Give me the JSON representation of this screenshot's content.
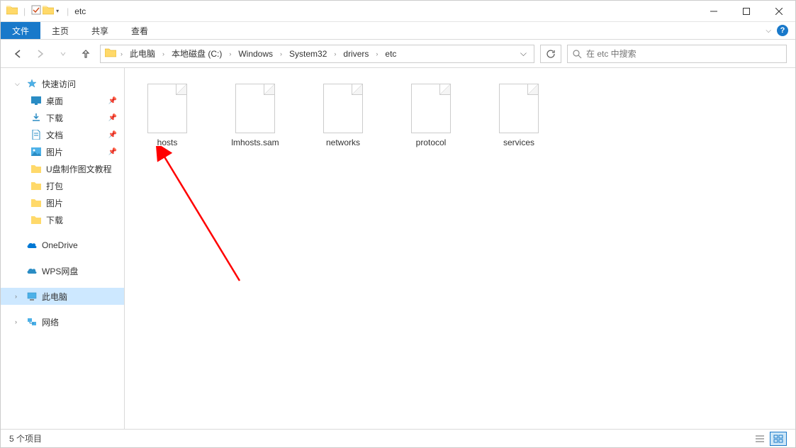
{
  "titlebar": {
    "title": "etc"
  },
  "ribbon": {
    "tabs": [
      "文件",
      "主页",
      "共享",
      "查看"
    ]
  },
  "breadcrumb": {
    "segments": [
      "此电脑",
      "本地磁盘 (C:)",
      "Windows",
      "System32",
      "drivers",
      "etc"
    ]
  },
  "search": {
    "placeholder": "在 etc 中搜索"
  },
  "sidebar": {
    "quick_access": "快速访问",
    "quick_items": [
      {
        "label": "桌面",
        "icon": "desktop",
        "pinned": true
      },
      {
        "label": "下载",
        "icon": "download",
        "pinned": true
      },
      {
        "label": "文档",
        "icon": "document",
        "pinned": true
      },
      {
        "label": "图片",
        "icon": "picture",
        "pinned": true
      },
      {
        "label": "U盘制作图文教程",
        "icon": "folder",
        "pinned": false
      },
      {
        "label": "打包",
        "icon": "folder",
        "pinned": false
      },
      {
        "label": "图片",
        "icon": "folder",
        "pinned": false
      },
      {
        "label": "下载",
        "icon": "folder",
        "pinned": false
      }
    ],
    "onedrive": "OneDrive",
    "wps": "WPS网盘",
    "this_pc": "此电脑",
    "network": "网络"
  },
  "files": [
    {
      "name": "hosts"
    },
    {
      "name": "lmhosts.sam"
    },
    {
      "name": "networks"
    },
    {
      "name": "protocol"
    },
    {
      "name": "services"
    }
  ],
  "statusbar": {
    "text": "5 个项目"
  }
}
